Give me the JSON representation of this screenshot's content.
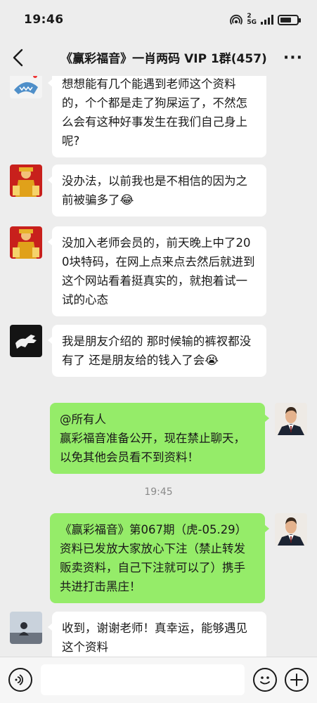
{
  "status_bar": {
    "time": "19:46",
    "network": "5G",
    "sim_badge": "2"
  },
  "header": {
    "title": "《赢彩福音》一肖两码 VIP 1群(457)",
    "more_label": "···"
  },
  "messages": [
    {
      "side": "left",
      "avatar": "shark-avatar",
      "text": "想想能有几个能遇到老师这个资料的，个个都是走了狗屎运了，不然怎么会有这种好事发生在我们自己身上呢?"
    },
    {
      "side": "left",
      "avatar": "wealth-god-avatar",
      "text": "没办法，以前我也是不相信的因为之前被骗多了",
      "emoji": "😂"
    },
    {
      "side": "left",
      "avatar": "wealth-god-avatar",
      "text": "没加入老师会员的，前天晚上中了200块特码，在网上点来点去然后就进到这个网站看着挺真实的，就抱着试一试的心态"
    },
    {
      "side": "left",
      "avatar": "horse-avatar",
      "text": "我是朋友介绍的 那时候输的裤衩都没有了 还是朋友给的钱入了会",
      "emoji": "😭"
    },
    {
      "side": "right",
      "avatar": "suit-man-avatar",
      "text_lines": [
        "@所有人",
        "赢彩福音准备公开，现在禁止聊天，以免其他会员看不到资料！"
      ]
    },
    {
      "side": "right",
      "avatar": "suit-man-avatar",
      "text": "《赢彩福音》第067期（虎-05.29）资料已发放大家放心下注（禁止转发贩卖资料，自己下注就可以了）携手共进打击黑庄！"
    },
    {
      "side": "left",
      "avatar": "silhouette-avatar",
      "text": "收到，谢谢老师！真幸运，能够遇见这个资料"
    }
  ],
  "timestamp": "19:45",
  "colors": {
    "background": "#ededed",
    "bubble_left": "#ffffff",
    "bubble_right": "#95ec69",
    "input_bar": "#f6f6f6"
  },
  "input_bar": {
    "icons": [
      "voice-icon",
      "emoji-icon",
      "plus-icon"
    ]
  }
}
